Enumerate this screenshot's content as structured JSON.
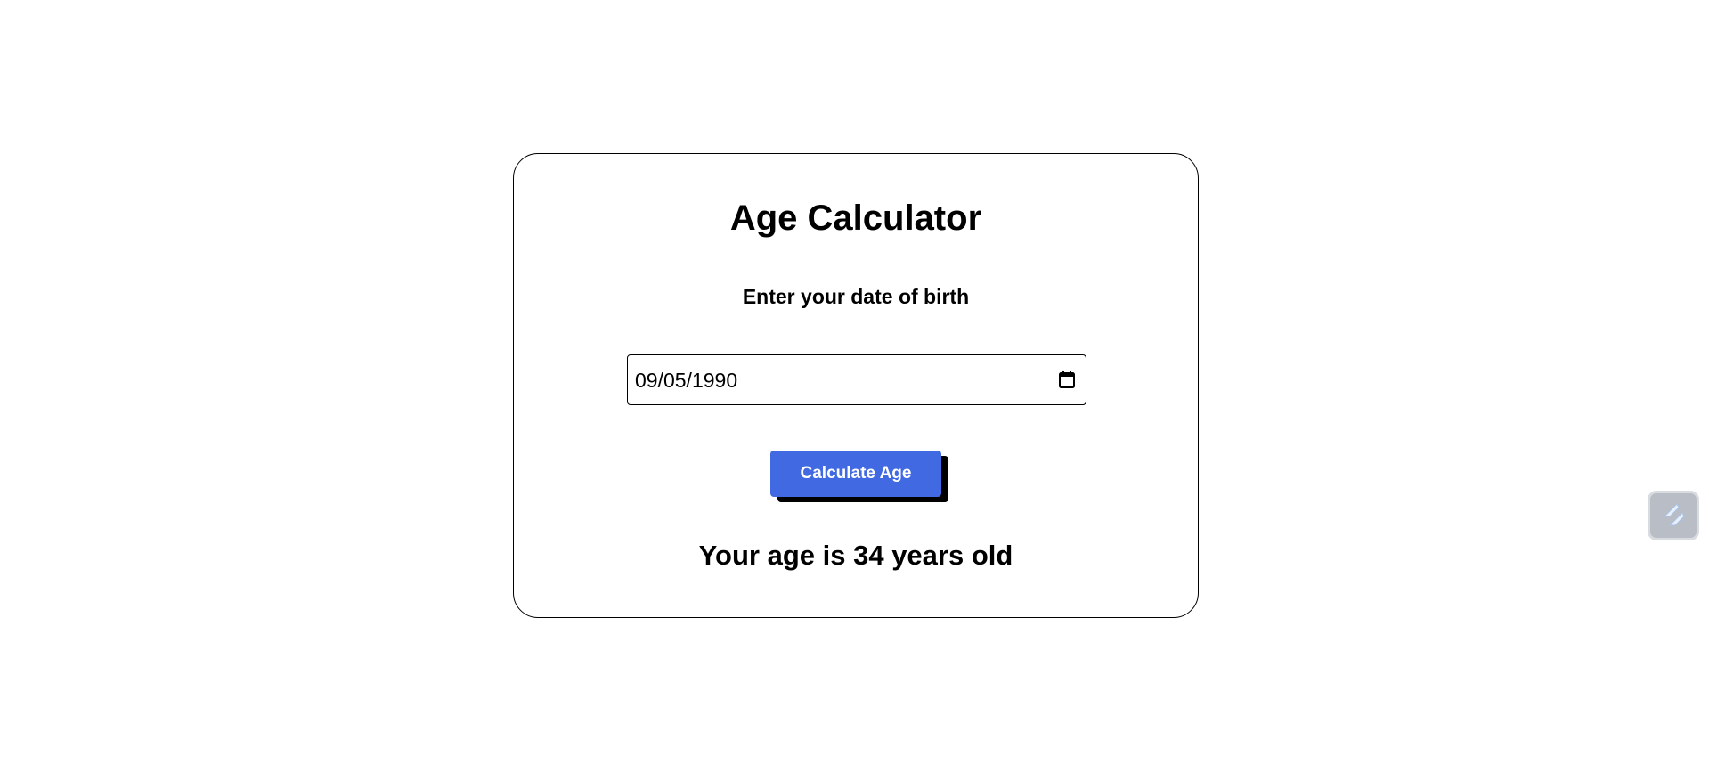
{
  "app": {
    "title": "Age Calculator",
    "subtitle": "Enter your date of birth"
  },
  "form": {
    "date_value": "09/05/1990",
    "date_icon": "calendar-icon",
    "submit_label": "Calculate Age"
  },
  "result": {
    "text": "Your age is 34 years old"
  },
  "extension": {
    "icon": "extension-icon"
  },
  "colors": {
    "button": "#4169e1",
    "button_text": "#ffffff",
    "button_shadow": "#000000",
    "border": "#000000",
    "background": "#ffffff"
  }
}
